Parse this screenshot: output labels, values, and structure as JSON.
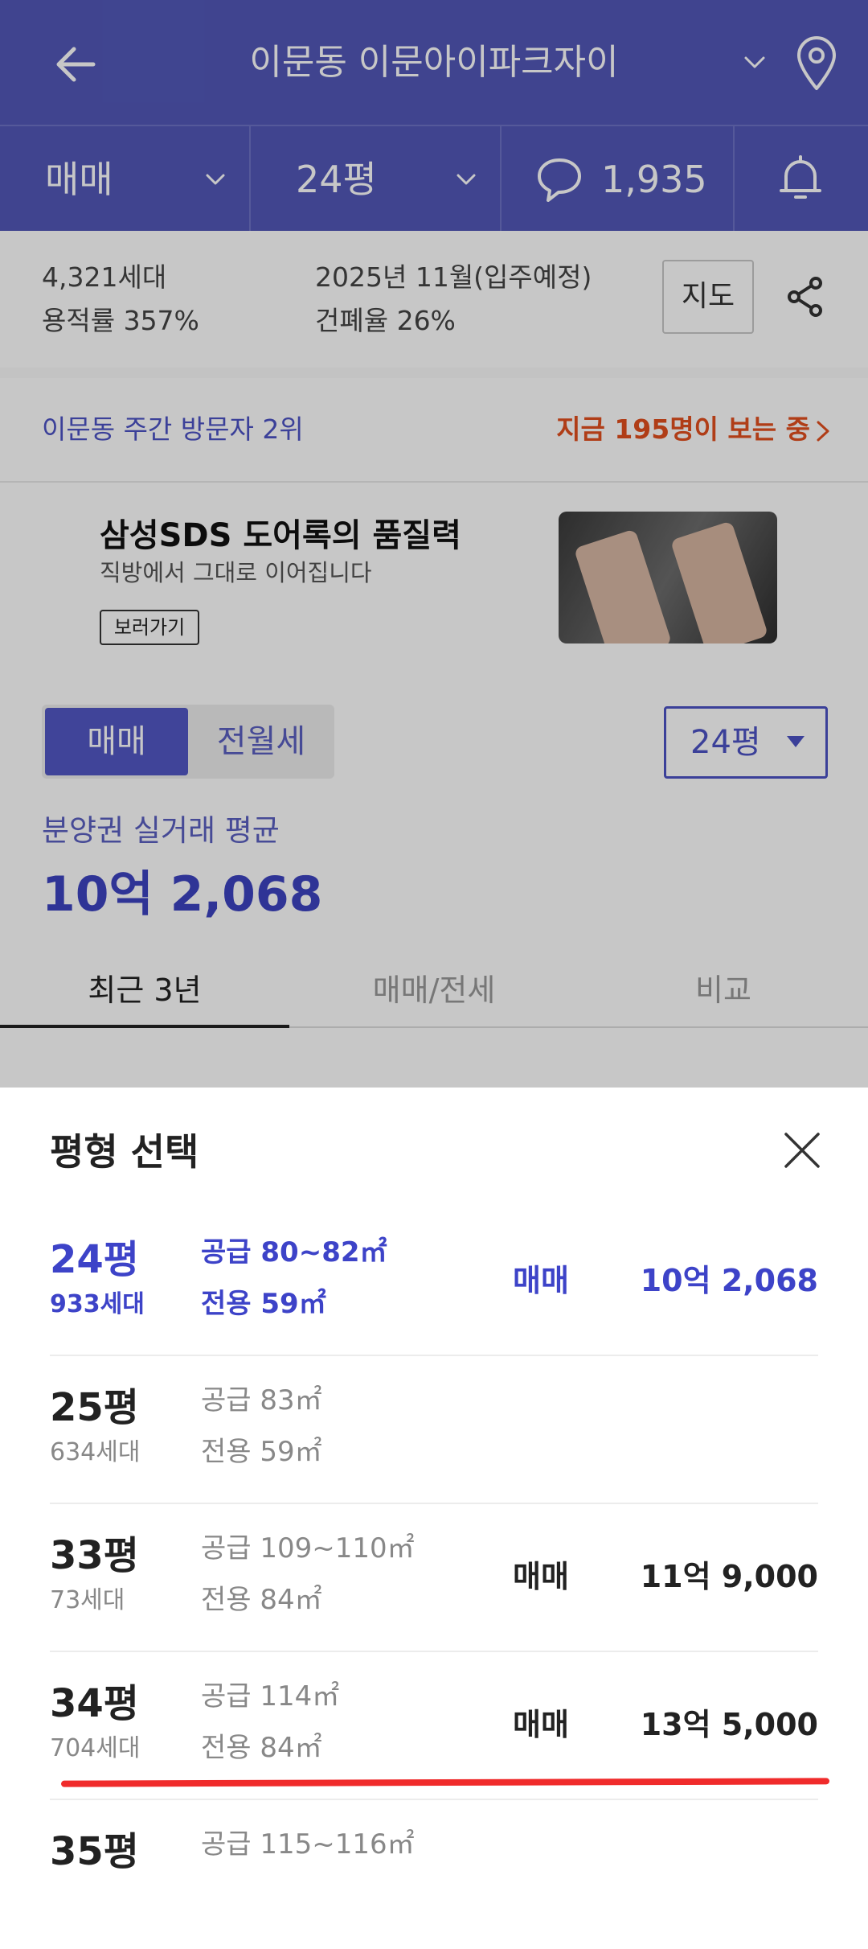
{
  "header": {
    "title": "이문동 이문아이파크자이"
  },
  "subheader": {
    "trade_type": "매매",
    "size": "24평",
    "comment_count": "1,935"
  },
  "info": {
    "households": "4,321세대",
    "floor_area_ratio": "용적률 357%",
    "move_in": "2025년 11월(입주예정)",
    "coverage_ratio": "건폐율 26%",
    "map_label": "지도"
  },
  "visitor": {
    "rank": "이문동 주간 방문자 2위",
    "viewing_now": "지금 195명이 보는 중"
  },
  "ad": {
    "headline": "삼성SDS 도어록의 품질력",
    "subtext": "직방에서 그대로 이어집니다",
    "cta": "보러가기"
  },
  "filters": {
    "segment_active": "매매",
    "segment_inactive": "전월세",
    "size_select": "24평",
    "avg_label": "분양권 실거래 평균",
    "avg_price": "10억 2,068",
    "tabs": [
      "최근 3년",
      "매매/전세",
      "비교"
    ]
  },
  "sheet": {
    "title": "평형 선택",
    "rows": [
      {
        "pyeong": "24평",
        "households": "933세대",
        "supply": "공급 80~82㎡",
        "exclusive": "전용 59㎡",
        "type": "매매",
        "price": "10억 2,068"
      },
      {
        "pyeong": "25평",
        "households": "634세대",
        "supply": "공급 83㎡",
        "exclusive": "전용 59㎡",
        "type": "",
        "price": ""
      },
      {
        "pyeong": "33평",
        "households": "73세대",
        "supply": "공급 109~110㎡",
        "exclusive": "전용 84㎡",
        "type": "매매",
        "price": "11억 9,000"
      },
      {
        "pyeong": "34평",
        "households": "704세대",
        "supply": "공급 114㎡",
        "exclusive": "전용 84㎡",
        "type": "매매",
        "price": "13억 5,000"
      },
      {
        "pyeong": "35평",
        "households": "",
        "supply": "공급 115~116㎡",
        "exclusive": "",
        "type": "",
        "price": ""
      }
    ]
  },
  "colors": {
    "brand": "#5258b8",
    "accent": "#3d43c8",
    "alert": "#e24f1e",
    "highlight_line": "#f02b2b"
  },
  "icons": [
    "back-arrow-icon",
    "chevron-down-icon",
    "location-pin-icon",
    "comment-icon",
    "bell-icon",
    "share-icon",
    "chevron-right-icon",
    "close-icon"
  ]
}
